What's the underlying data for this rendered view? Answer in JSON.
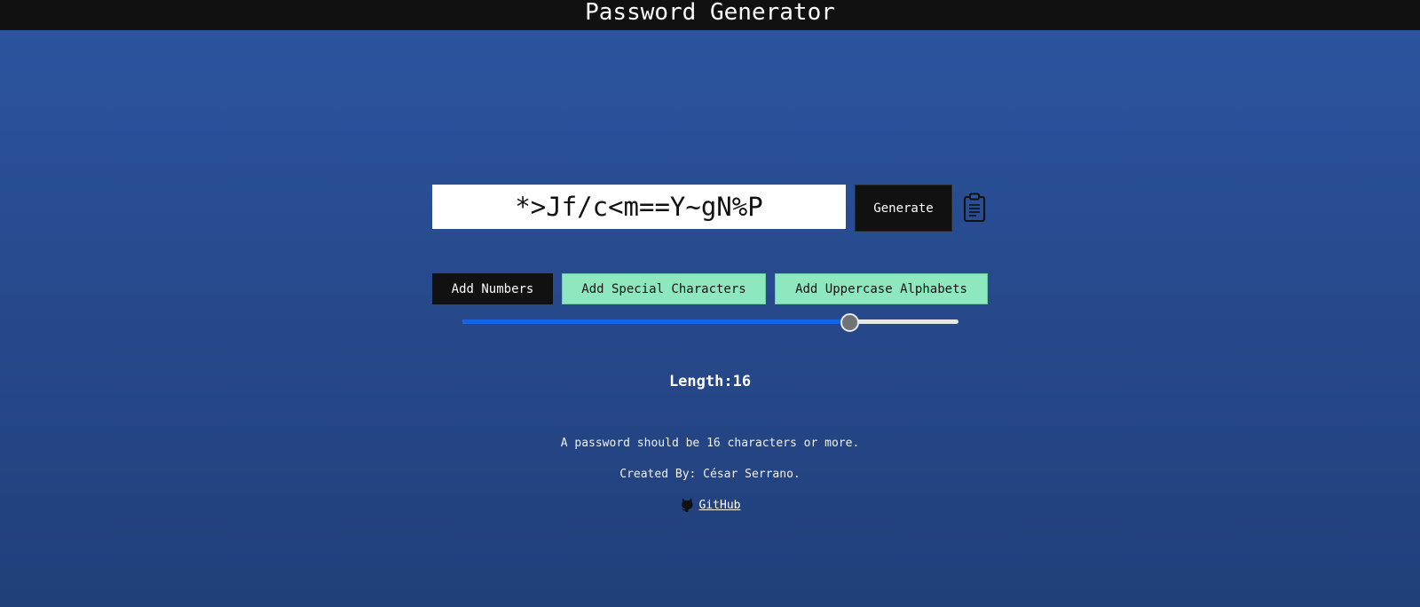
{
  "header": {
    "title": "Password Generator"
  },
  "password": {
    "value": "*>Jf/c<m==Y~gN%P"
  },
  "actions": {
    "generate_label": "Generate",
    "copy_icon": "clipboard-icon"
  },
  "options": [
    {
      "label": "Add Numbers",
      "active": false
    },
    {
      "label": "Add Special Characters",
      "active": true
    },
    {
      "label": "Add Uppercase Alphabets",
      "active": true
    }
  ],
  "length": {
    "label": "Length:16",
    "value": 16,
    "slider_fraction": 0.78
  },
  "footer": {
    "hint": "A password should be 16 characters or more.",
    "credit": "Created By: César Serrano.",
    "github_label": "GitHub",
    "github_icon": "github-icon"
  },
  "colors": {
    "topbar": "#111111",
    "background_top": "#2b55a0",
    "background_bottom": "#213f7a",
    "option_active": "#8ee8bf",
    "slider_fill": "#1763e6"
  }
}
